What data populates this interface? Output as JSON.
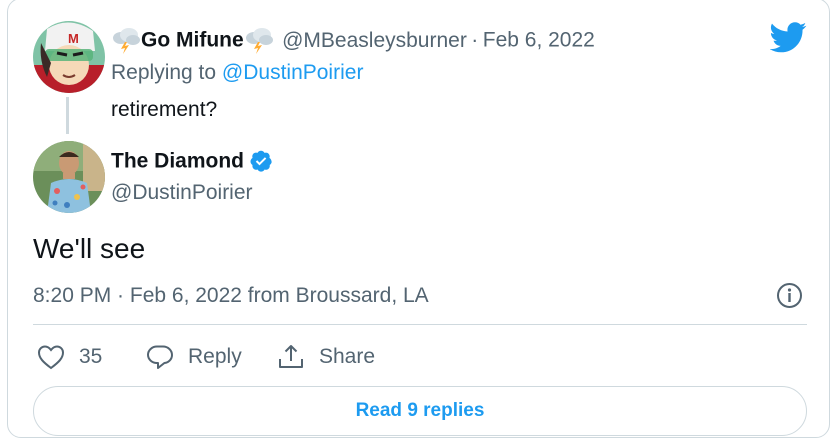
{
  "parent_tweet": {
    "display_name": "Go Mifune",
    "name_emoji": "cloud-lightning-icon",
    "handle": "@MBeasleysburner",
    "separator": "·",
    "date": "Feb 6, 2022",
    "replying_prefix": "Replying to",
    "replying_to": "@DustinPoirier",
    "text": "retirement?"
  },
  "main_tweet": {
    "display_name": "The Diamond",
    "verified": true,
    "handle": "@DustinPoirier",
    "text": "We'll see",
    "timestamp": "8:20 PM · Feb 6, 2022 from Broussard, LA"
  },
  "actions": {
    "like_count": "35",
    "reply_label": "Reply",
    "share_label": "Share"
  },
  "read_replies_label": "Read 9 replies",
  "colors": {
    "accent": "#1d9bf0",
    "text": "#0f1419",
    "secondary": "#536471",
    "border": "#cfd9de"
  }
}
